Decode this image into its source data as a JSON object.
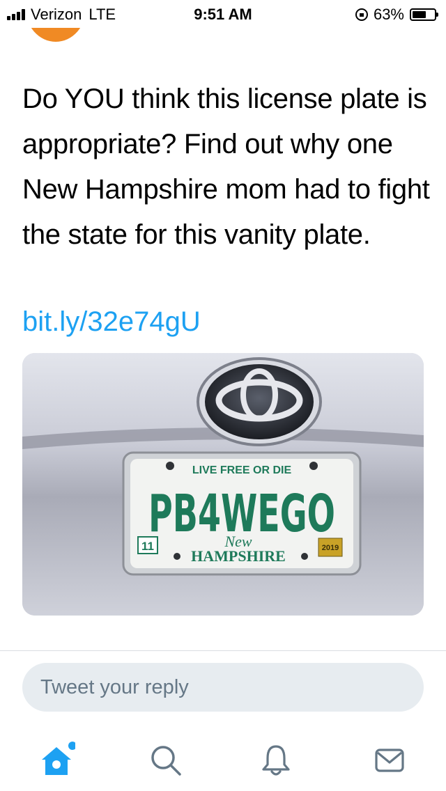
{
  "status_bar": {
    "carrier": "Verizon",
    "network": "LTE",
    "time": "9:51 AM",
    "battery": "63%",
    "battery_level": 0.63
  },
  "tweet": {
    "text": "Do YOU think this license plate is appropriate? Find out why one New Hampshire mom had to fight the state for this vanity plate.",
    "link": "bit.ly/32e74gU"
  },
  "media": {
    "plate_slogan": "LIVE FREE OR DIE",
    "plate_number": "PB4WEGO",
    "plate_state_script": "New",
    "plate_state": "HAMPSHIRE",
    "plate_month": "11",
    "plate_year": "2019",
    "plate_color": "#1e7a5a"
  },
  "reply": {
    "placeholder": "Tweet your reply"
  },
  "tabbar": {
    "accent_color": "#1da1f2",
    "icon_color": "#657786",
    "tabs": [
      "home-icon",
      "search-icon",
      "notifications-icon",
      "messages-icon"
    ]
  }
}
